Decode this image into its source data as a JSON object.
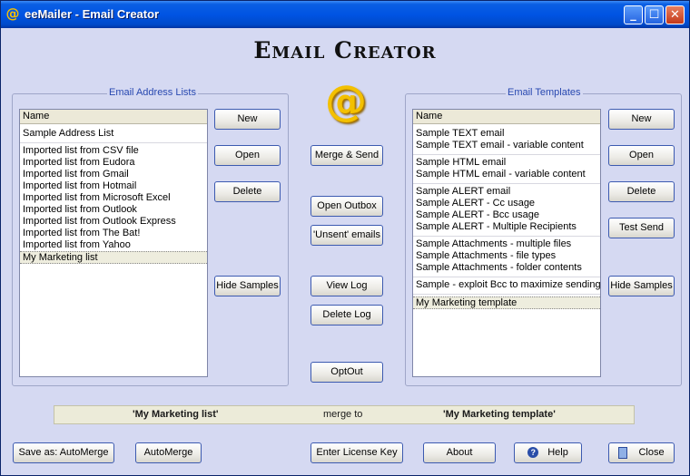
{
  "window": {
    "title": "eeMailer - Email Creator",
    "icon": "@",
    "controls": [
      "_",
      "☐",
      "✕"
    ]
  },
  "heading": "Email Creator",
  "address_lists": {
    "group_label": "Email Address Lists",
    "header": "Name",
    "sample_item": "Sample Address List",
    "items": [
      "Imported list from CSV file",
      "Imported list from Eudora",
      "Imported list from Gmail",
      "Imported list from Hotmail",
      "Imported list from Microsoft Excel",
      "Imported list from Outlook",
      "Imported list from Outlook Express",
      "Imported list from The Bat!",
      "Imported list from Yahoo"
    ],
    "selected_item": "My Marketing list",
    "buttons": {
      "new": "New",
      "open": "Open",
      "delete": "Delete",
      "hide_samples": "Hide Samples"
    }
  },
  "center_buttons": {
    "merge_send": "Merge & Send",
    "open_outbox": "Open Outbox",
    "unsent": "'Unsent' emails",
    "view_log": "View Log",
    "delete_log": "Delete Log",
    "optout": "OptOut"
  },
  "logo_glyph": "@",
  "templates": {
    "group_label": "Email Templates",
    "header": "Name",
    "groups": [
      [
        "Sample TEXT email",
        "Sample TEXT email - variable content"
      ],
      [
        "Sample HTML email",
        "Sample HTML email - variable content"
      ],
      [
        "Sample ALERT email",
        "Sample ALERT - Cc usage",
        "Sample ALERT - Bcc usage",
        "Sample ALERT - Multiple Recipients"
      ],
      [
        "Sample Attachments - multiple files",
        "Sample Attachments - file types",
        "Sample Attachments - folder contents"
      ],
      [
        "Sample - exploit Bcc to maximize sending"
      ]
    ],
    "selected_item": "My Marketing template",
    "buttons": {
      "new": "New",
      "open": "Open",
      "delete": "Delete",
      "test_send": "Test Send",
      "hide_samples": "Hide Samples"
    }
  },
  "status": {
    "list": "'My Marketing list'",
    "middle": "merge to",
    "template": "'My Marketing template'"
  },
  "footer": {
    "save_as": "Save as: AutoMerge",
    "automerge": "AutoMerge",
    "license": "Enter License Key",
    "about": "About",
    "help": "Help",
    "close": "Close"
  }
}
